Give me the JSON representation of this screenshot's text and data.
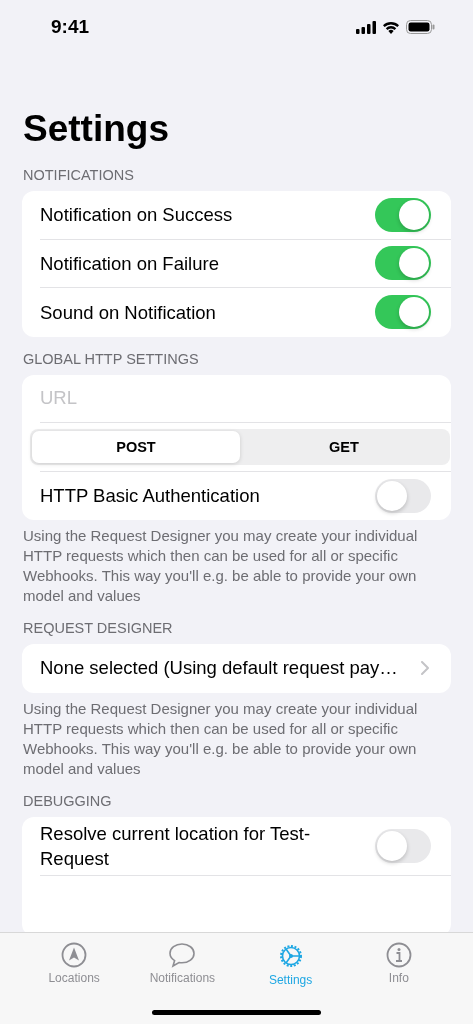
{
  "status_bar": {
    "time": "9:41"
  },
  "title": "Settings",
  "sections": [
    {
      "header": "NOTIFICATIONS",
      "rows": [
        {
          "kind": "toggle",
          "label": "Notification on Success",
          "on": true
        },
        {
          "kind": "toggle",
          "label": "Notification on Failure",
          "on": true
        },
        {
          "kind": "toggle",
          "label": "Sound on Notification",
          "on": true
        }
      ]
    },
    {
      "header": "GLOBAL HTTP SETTINGS",
      "rows": [
        {
          "kind": "field",
          "placeholder": "URL"
        },
        {
          "kind": "segmented",
          "segments": [
            {
              "label": "POST",
              "selected": true
            },
            {
              "label": "GET",
              "selected": false
            }
          ]
        },
        {
          "kind": "toggle",
          "label": "HTTP Basic Authentication",
          "on": false
        }
      ],
      "footer": "Using the Request Designer you may create your individual HTTP requests which then can be used for all or specific Webhooks. This way you'll e.g. be able to provide your own model and values"
    },
    {
      "header": "REQUEST DESIGNER",
      "rows": [
        {
          "kind": "link",
          "label": "None selected (Using default request pay…"
        }
      ],
      "footer": "Using the Request Designer you may create your individual HTTP requests which then can be used for all or specific Webhooks. This way you'll e.g. be able to provide your own model and values"
    },
    {
      "header": "DEBUGGING",
      "rows": [
        {
          "kind": "toggle",
          "label": "Resolve current location for Test-Request",
          "on": false
        }
      ]
    }
  ],
  "tab_bar": {
    "tabs": [
      {
        "kind": "locations",
        "label": "Locations",
        "selected": false
      },
      {
        "kind": "notifications",
        "label": "Notifications",
        "selected": false
      },
      {
        "kind": "settings",
        "label": "Settings",
        "selected": true
      },
      {
        "kind": "info",
        "label": "Info",
        "selected": false
      }
    ]
  }
}
